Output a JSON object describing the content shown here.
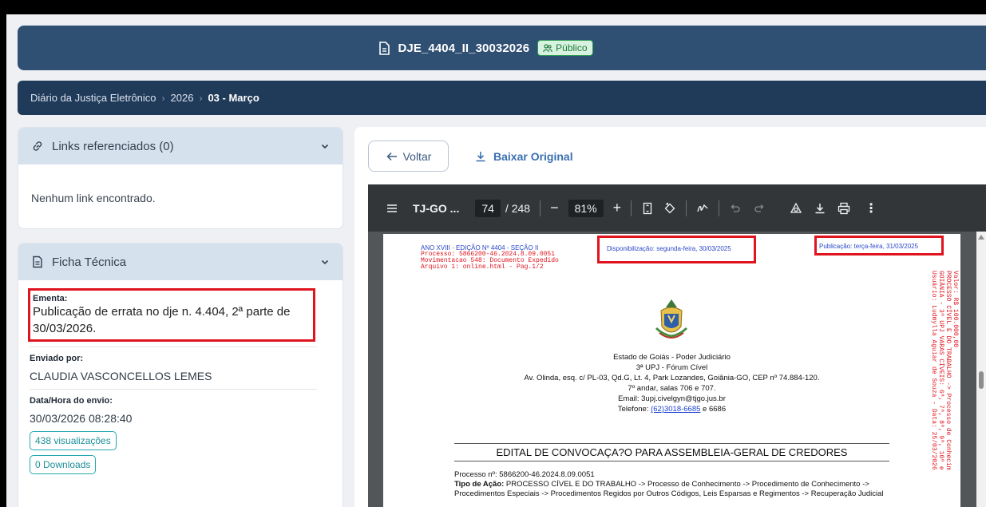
{
  "header": {
    "title": "DJE_4404_II_30032026",
    "badge": "Público"
  },
  "breadcrumb": {
    "items": [
      "Diário da Justiça Eletrônico",
      "2026"
    ],
    "current": "03 - Março"
  },
  "links_panel": {
    "title": "Links referenciados (0)",
    "empty_text": "Nenhum link encontrado."
  },
  "ficha": {
    "title": "Ficha Técnica",
    "ementa_label": "Ementa:",
    "ementa_value": "Publicação de errata no dje n. 4.404, 2ª parte de 30/03/2026.",
    "enviado_label": "Enviado por:",
    "enviado_value": "CLAUDIA VASCONCELLOS LEMES",
    "data_label": "Data/Hora do envio:",
    "data_value": "30/03/2026 08:28:40",
    "views": "438 visualizações",
    "downloads": "0 Downloads"
  },
  "actions": {
    "voltar": "Voltar",
    "baixar": "Baixar Original"
  },
  "viewer": {
    "doc_title": "TJ-GO ...",
    "page_current": "74",
    "page_total": "/ 248",
    "zoom": "81%"
  },
  "page": {
    "edition": "ANO XVIII - EDIÇÃO Nº 4404 - SEÇÃO II",
    "processo_line": "Processo: 5866200-46.2024.8.09.0051",
    "movimentacao": "Movimentacao 548: Documento Expedido",
    "arquivo": "Arquivo 1: online.html - Pag.1/2",
    "disponibilizacao": "Disponibilização: segunda-feira, 30/03/2025",
    "publicacao": "Publicação: terça-feira, 31/03/2025",
    "org1": "Estado de Goiás - Poder Judiciário",
    "org2": "3ª UPJ - Fórum Cível",
    "org3": "Av. Olinda, esq. c/ PL-03, Qd.G, Lt. 4, Park Lozandes, Goiânia-GO, CEP nº 74.884-120.",
    "org4": "7º andar, salas 706 e 707.",
    "org5": "Email: 3upj.civelgyn@tjgo.jus.br",
    "org6_prefix": "Telefone: ",
    "org6_link": "(62)3018-6685",
    "org6_suffix": " e 6686",
    "edital": "EDITAL DE CONVOCAÇA?O PARA ASSEMBLEIA-GERAL DE CREDORES",
    "proc_n": "Processo nº: 5866200-46.2024.8.09.0051",
    "tipo_label": "Tipo de Ação:",
    "tipo_value": " PROCESSO CÍVEL E DO TRABALHO -> Processo de Conhecimento -> Procedimento de Conhecimento -> Procedimentos Especiais -> Procedimentos Regidos por Outros Códigos, Leis Esparsas e Regimentos -> Recuperação Judicial",
    "vertical1": "Valor: R$ 100.000,00",
    "vertical2": "PROCESSO CÍVEL E DO TRABALHO -> Processo de Conhecim",
    "vertical3": "GOIÂNIA - 3ª UPJ VARAS CÍVEIS: 6ª, 7ª, 8ª, 9ª, 10ª e",
    "vertical4": "Usuário: Ludmylla Aguiar de Souza - Data: 25/03/2026"
  }
}
